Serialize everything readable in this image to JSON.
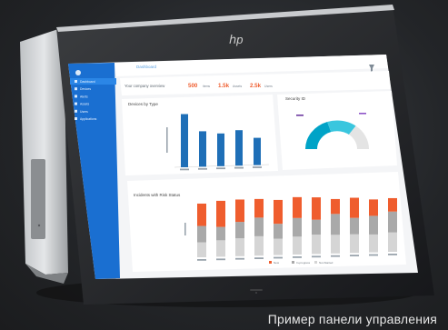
{
  "brand": {
    "logo_text": "ℎp"
  },
  "app": {
    "header_title": "Dashboard",
    "summary_label": "Your company overview",
    "stats": [
      {
        "value": "500",
        "unit": "items",
        "color": "#ef5d2e"
      },
      {
        "value": "1.5k",
        "unit": "Assets",
        "color": "#ef5d2e"
      },
      {
        "value": "2.5k",
        "unit": "Users",
        "color": "#ef5d2e"
      }
    ],
    "sidebar": {
      "items": [
        {
          "label": "Dashboard"
        },
        {
          "label": "Devices"
        },
        {
          "label": "Alerts"
        },
        {
          "label": "Assets"
        },
        {
          "label": "Users"
        },
        {
          "label": "Applications"
        }
      ]
    },
    "filter_icon": "filter-icon"
  },
  "caption": "Пример панели управления",
  "charts": {
    "chart_data": [
      {
        "type": "bar",
        "title": "Devices by Type",
        "values": [
          78,
          52,
          48,
          52,
          40
        ],
        "color": "#1f6fb7",
        "ylim": [
          0,
          100
        ]
      },
      {
        "type": "pie",
        "title": "Security ID",
        "values": [
          40,
          30,
          30
        ],
        "colors": [
          "#00a3c7",
          "#3ac6de",
          "#e4e4e4"
        ]
      },
      {
        "type": "bar",
        "title": "Incidents with Risk Status",
        "series": [
          {
            "name": "New",
            "color": "#ef5d2e",
            "values": [
              30,
              35,
              30,
              25,
              32,
              28,
              30,
              20,
              27,
              22,
              18
            ]
          },
          {
            "name": "In-progress",
            "color": "#a9a9a9",
            "values": [
              22,
              18,
              22,
              25,
              20,
              25,
              20,
              28,
              22,
              25,
              28
            ]
          },
          {
            "name": "Not-Started",
            "color": "#d5d5d5",
            "values": [
              20,
              22,
              24,
              26,
              22,
              24,
              26,
              25,
              25,
              24,
              26
            ]
          }
        ],
        "ylim": [
          0,
          100
        ]
      }
    ]
  }
}
